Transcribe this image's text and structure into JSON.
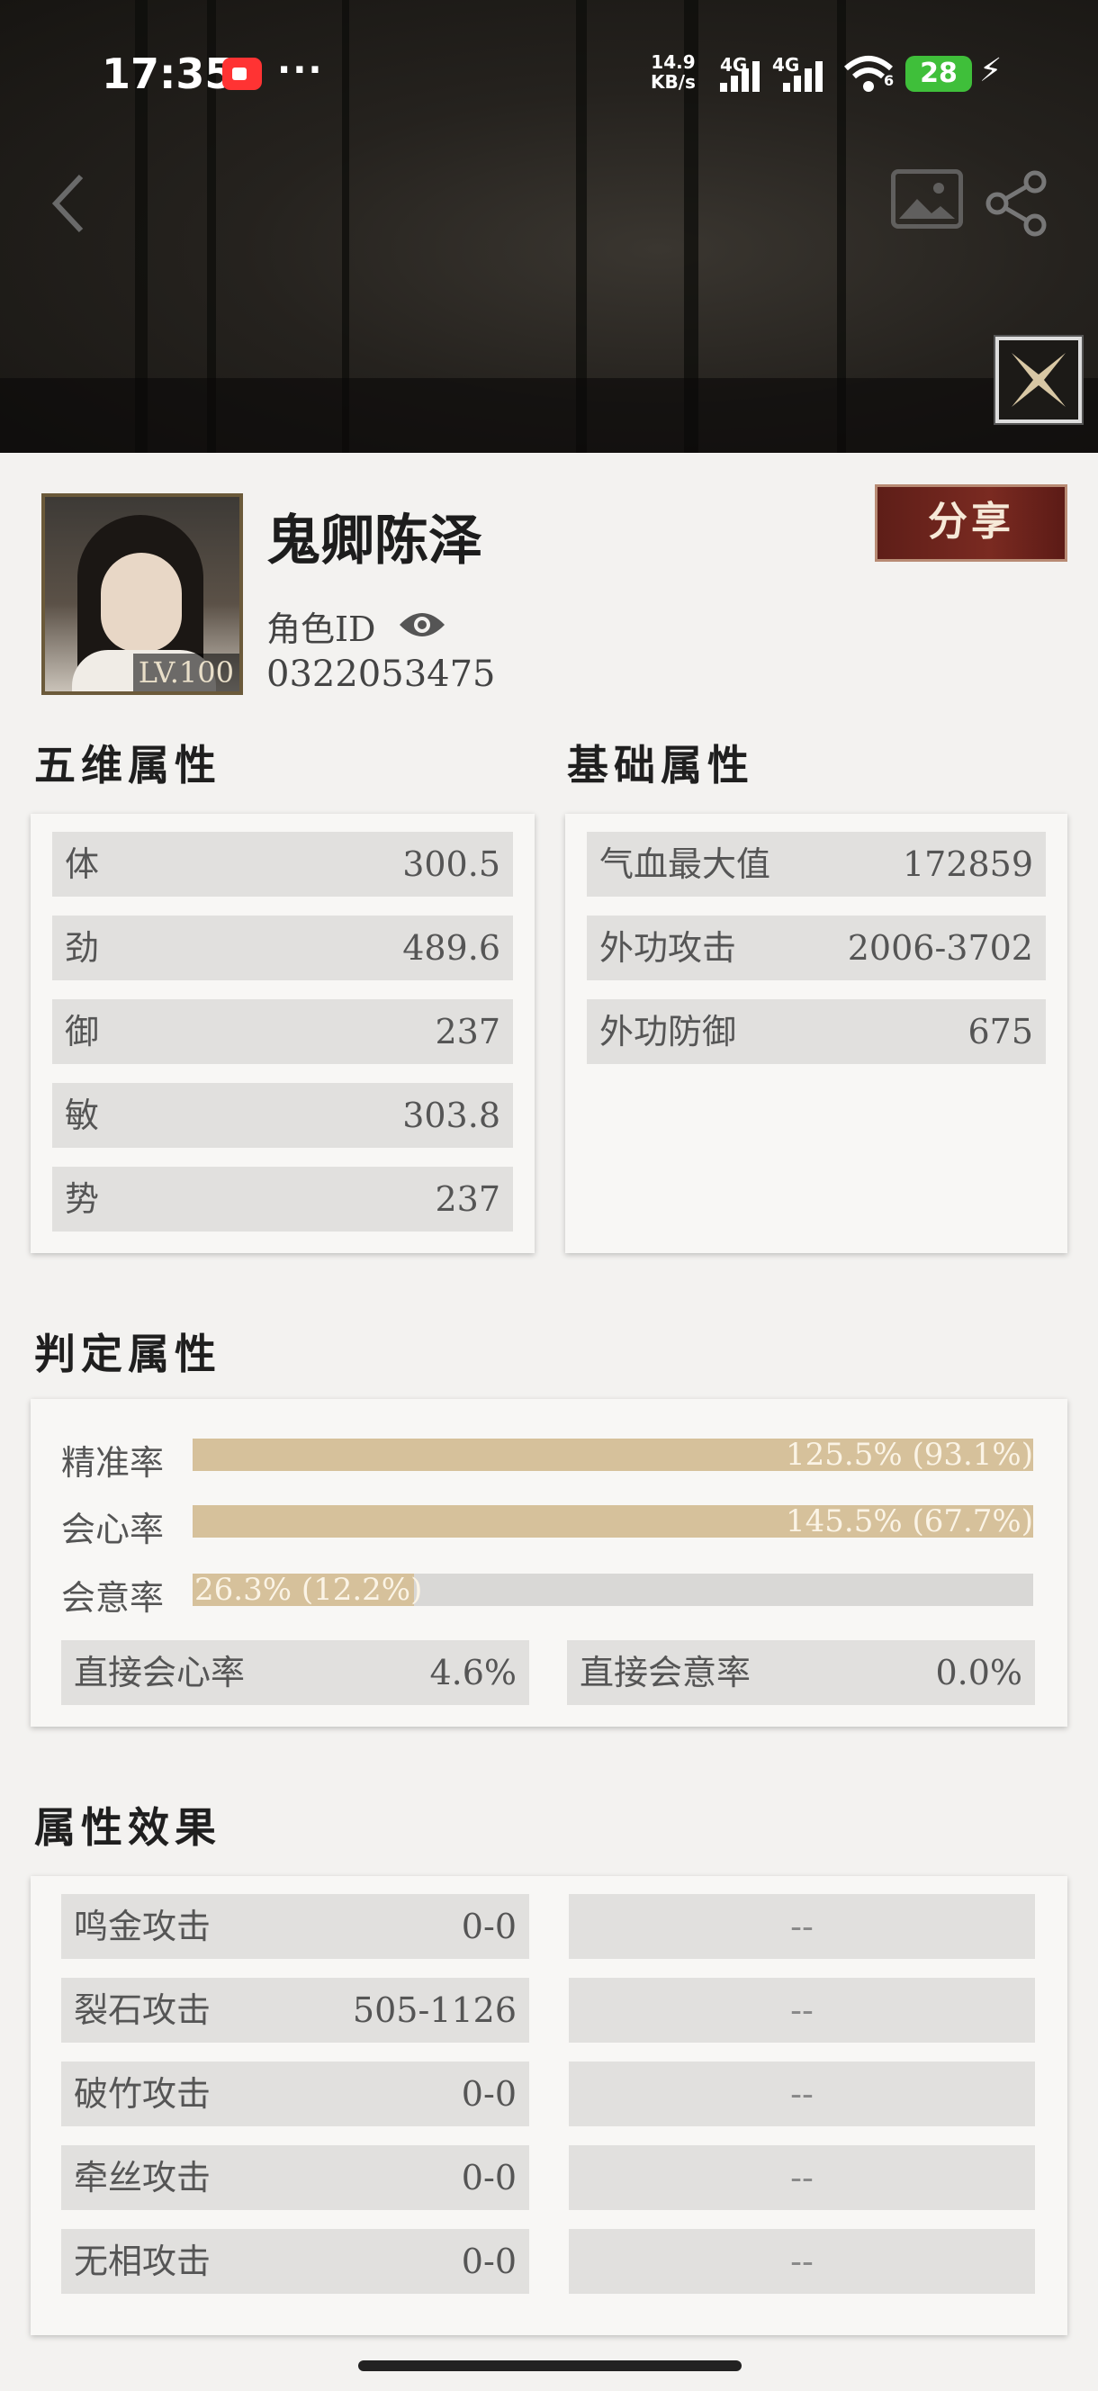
{
  "status_bar": {
    "time": "17:35",
    "dots": "···",
    "net_speed_top": "14.9",
    "net_speed_bottom": "KB/s",
    "signal1": "4G",
    "signal2": "4G",
    "wifi_badge": "6",
    "battery": "28"
  },
  "profile": {
    "name": "鬼卿陈泽",
    "level": "LV.100",
    "role_id_label": "角色ID",
    "role_id": "0322053475",
    "share_label": "分享"
  },
  "five_dims": {
    "title": "五维属性",
    "rows": [
      {
        "label": "体",
        "value": "300.5"
      },
      {
        "label": "劲",
        "value": "489.6"
      },
      {
        "label": "御",
        "value": "237"
      },
      {
        "label": "敏",
        "value": "303.8"
      },
      {
        "label": "势",
        "value": "237"
      }
    ]
  },
  "basic": {
    "title": "基础属性",
    "rows": [
      {
        "label": "气血最大值",
        "value": "172859"
      },
      {
        "label": "外功攻击",
        "value": "2006-3702"
      },
      {
        "label": "外功防御",
        "value": "675"
      }
    ]
  },
  "judge": {
    "title": "判定属性",
    "bars": [
      {
        "label": "精准率",
        "text": "125.5% (93.1%)",
        "fill": 1.0
      },
      {
        "label": "会心率",
        "text": "145.5% (67.7%)",
        "fill": 1.0
      },
      {
        "label": "会意率",
        "text": "26.3% (12.2%)",
        "fill": 0.263
      }
    ],
    "direct": [
      {
        "label": "直接会心率",
        "value": "4.6%"
      },
      {
        "label": "直接会意率",
        "value": "0.0%"
      }
    ]
  },
  "effects": {
    "title": "属性效果",
    "rows": [
      {
        "label": "鸣金攻击",
        "value": "0-0",
        "right": "--"
      },
      {
        "label": "裂石攻击",
        "value": "505-1126",
        "right": "--"
      },
      {
        "label": "破竹攻击",
        "value": "0-0",
        "right": "--"
      },
      {
        "label": "牵丝攻击",
        "value": "0-0",
        "right": "--"
      },
      {
        "label": "无相攻击",
        "value": "0-0",
        "right": "--"
      }
    ]
  }
}
